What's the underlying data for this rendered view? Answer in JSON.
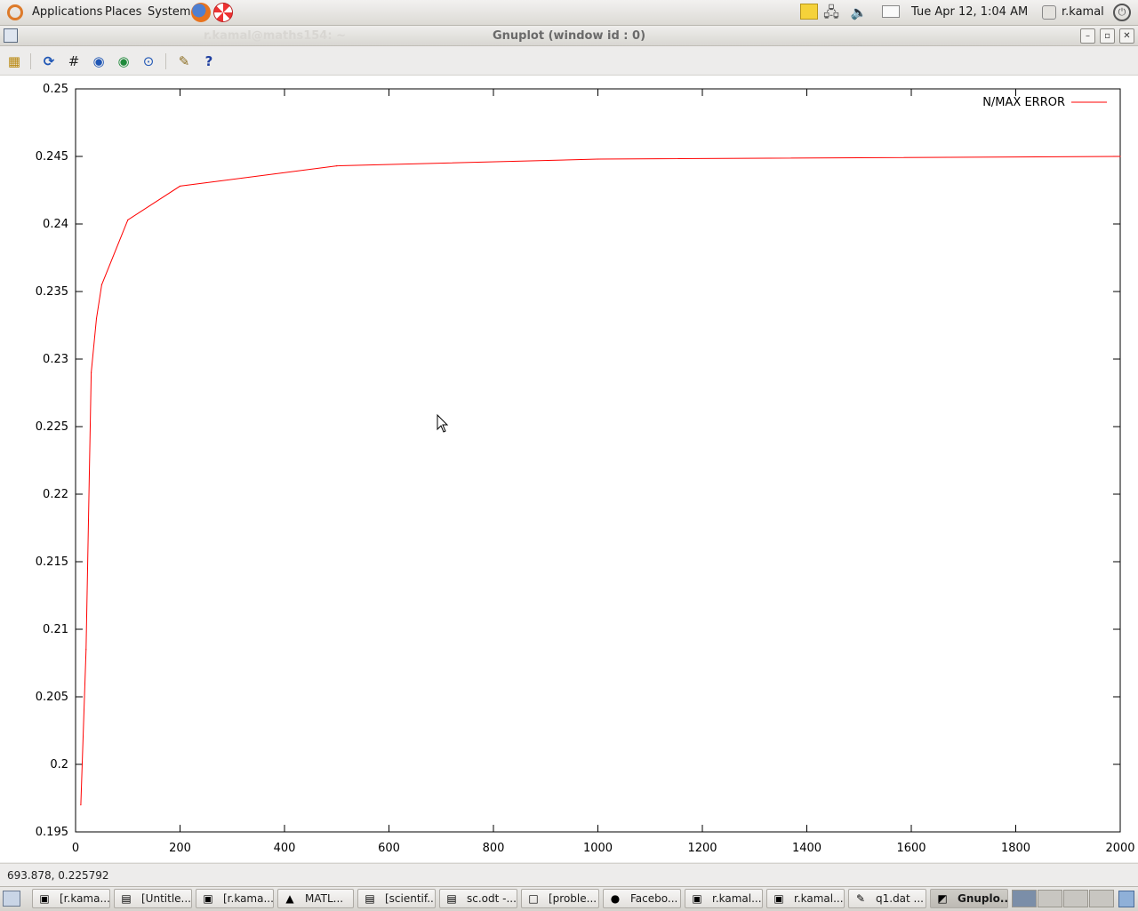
{
  "top_panel": {
    "menus": [
      "Applications",
      "Places",
      "System"
    ],
    "clock": "Tue Apr 12,  1:04 AM",
    "user": "r.kamal"
  },
  "window": {
    "title": "Gnuplot (window id : 0)",
    "ghost_title": "r.kamal@maths154: ~"
  },
  "toolbar": {
    "icons": [
      "copy-to-clipboard-icon",
      "replot-icon",
      "grid-icon",
      "zoom-previous-icon",
      "zoom-next-icon",
      "unzoom-icon",
      "options-icon",
      "help-icon"
    ]
  },
  "chart_data": {
    "type": "line",
    "title": "",
    "xlabel": "",
    "ylabel": "",
    "xlim": [
      0,
      2000
    ],
    "ylim": [
      0.195,
      0.25
    ],
    "x_ticks": [
      "0",
      "200",
      "400",
      "600",
      "800",
      "1000",
      "1200",
      "1400",
      "1600",
      "1800",
      "2000"
    ],
    "y_ticks": [
      "0.195",
      "0.2",
      "0.205",
      "0.21",
      "0.215",
      "0.22",
      "0.225",
      "0.23",
      "0.235",
      "0.24",
      "0.245",
      "0.25"
    ],
    "legend_position": "top-right",
    "series": [
      {
        "name": "N/MAX ERROR",
        "color": "#ff0000",
        "x": [
          10,
          20,
          30,
          40,
          50,
          100,
          200,
          500,
          1000,
          2000
        ],
        "y": [
          0.197,
          0.2085,
          0.229,
          0.233,
          0.2355,
          0.2403,
          0.2428,
          0.2443,
          0.2448,
          0.245
        ]
      }
    ]
  },
  "statusbar": {
    "coords": "693.878,  0.225792"
  },
  "taskbar": {
    "tasks": [
      {
        "label": "[r.kama...",
        "icon": "terminal-icon",
        "glyph": "▣"
      },
      {
        "label": "[Untitle...",
        "icon": "document-icon",
        "glyph": "▤"
      },
      {
        "label": "[r.kama...",
        "icon": "terminal-icon",
        "glyph": "▣"
      },
      {
        "label": "MATL...",
        "icon": "matlab-icon",
        "glyph": "▲"
      },
      {
        "label": "[scientif...",
        "icon": "document-icon",
        "glyph": "▤"
      },
      {
        "label": "sc.odt -...",
        "icon": "document-icon",
        "glyph": "▤"
      },
      {
        "label": "[proble...",
        "icon": "blank-document-icon",
        "glyph": "□"
      },
      {
        "label": "Facebo...",
        "icon": "firefox-icon",
        "glyph": "●"
      },
      {
        "label": "r.kamal...",
        "icon": "terminal-icon",
        "glyph": "▣"
      },
      {
        "label": "r.kamal...",
        "icon": "terminal-icon",
        "glyph": "▣"
      },
      {
        "label": "q1.dat ...",
        "icon": "text-editor-icon",
        "glyph": "✎"
      },
      {
        "label": "Gnuplo...",
        "icon": "gnuplot-icon",
        "glyph": "◩"
      }
    ]
  }
}
